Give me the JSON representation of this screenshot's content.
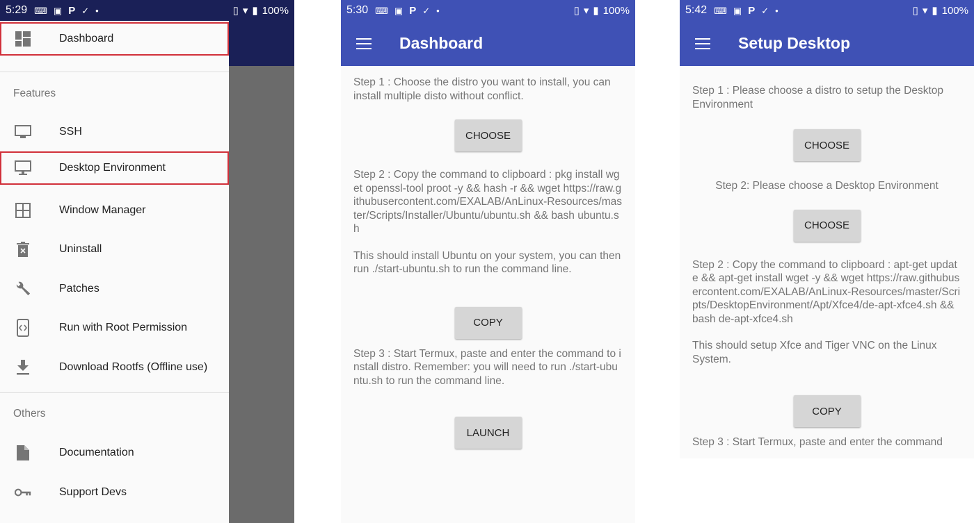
{
  "status_bar": {
    "phone1_time": "5:29",
    "phone2_time": "5:30",
    "phone3_time": "5:42",
    "battery": "100%"
  },
  "drawer": {
    "items_top": [
      {
        "label": "Dashboard",
        "icon": "dashboard-icon"
      }
    ],
    "features_header": "Features",
    "features": [
      {
        "label": "SSH",
        "icon": "monitor-icon"
      },
      {
        "label": "Desktop Environment",
        "icon": "desktop-icon"
      },
      {
        "label": "Window Manager",
        "icon": "grid-icon"
      },
      {
        "label": "Uninstall",
        "icon": "trash-icon"
      },
      {
        "label": "Patches",
        "icon": "wrench-icon"
      },
      {
        "label": "Run with Root Permission",
        "icon": "device-code-icon"
      },
      {
        "label": "Download Rootfs (Offline use)",
        "icon": "download-icon"
      }
    ],
    "others_header": "Others",
    "others": [
      {
        "label": "Documentation",
        "icon": "document-icon"
      },
      {
        "label": "Support Devs",
        "icon": "key-icon"
      }
    ]
  },
  "dashboard": {
    "title": "Dashboard",
    "step1": "Step 1 : Choose the distro you want to install, you can install multiple disto without conflict.",
    "choose_label": "CHOOSE",
    "step2": "Step 2 : Copy the command to clipboard : pkg install wget openssl-tool proot -y && hash -r && wget https://raw.githubusercontent.com/EXALAB/AnLinux-Resources/master/Scripts/Installer/Ubuntu/ubuntu.sh && bash ubuntu.sh",
    "step2_note": "This should install Ubuntu on your system, you can then run ./start-ubuntu.sh to run the command line.",
    "copy_label": "COPY",
    "step3": "Step 3 : Start Termux, paste and enter the command to install distro. Remember: you will need to run ./start-ubuntu.sh to run the command line.",
    "launch_label": "LAUNCH"
  },
  "setup_desktop": {
    "title": "Setup Desktop",
    "step1": "Step 1 : Please choose a distro to setup the Desktop Environment",
    "choose1_label": "CHOOSE",
    "step2a": "Step 2: Please choose a Desktop Environment",
    "choose2_label": "CHOOSE",
    "step2b": "Step 2 : Copy the command to clipboard : apt-get update && apt-get install wget -y && wget https://raw.githubusercontent.com/EXALAB/AnLinux-Resources/master/Scripts/DesktopEnvironment/Apt/Xfce4/de-apt-xfce4.sh && bash de-apt-xfce4.sh",
    "step2_note": "This should setup Xfce and Tiger VNC on the Linux System.",
    "copy_label": "COPY",
    "step3": "Step 3 : Start Termux, paste and enter the command"
  },
  "colors": {
    "app_bar": "#3f51b5",
    "status_bar_dark": "#1a2057",
    "highlight_outline": "#d1303a",
    "button_bg": "#d6d6d6"
  }
}
